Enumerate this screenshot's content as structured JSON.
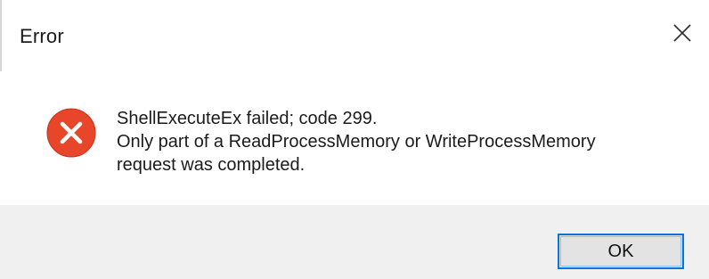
{
  "window": {
    "title": "Error",
    "close_icon": "close-icon"
  },
  "message": {
    "icon": "error-icon",
    "icon_color": "#e8462a",
    "line1": "ShellExecuteEx failed; code 299.",
    "line2": "Only part of a ReadProcessMemory or WriteProcessMemory",
    "line3": "request was completed."
  },
  "buttons": {
    "ok_label": "OK",
    "focus_color": "#0a74d9"
  }
}
